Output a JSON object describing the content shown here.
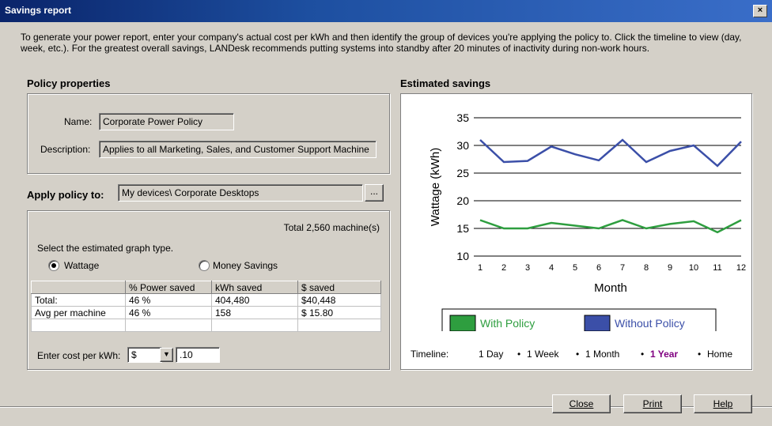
{
  "window": {
    "title": "Savings report",
    "close_glyph": "×"
  },
  "intro": "To generate your power report, enter your company's actual cost per kWh and then identify the group of devices you're applying the policy to. Click the timeline to view (day, week, etc.).  For the greatest overall savings, LANDesk recommends putting systems into standby after 20 minutes of inactivity during non-work hours.",
  "policy": {
    "heading": "Policy properties",
    "name_label": "Name:",
    "name_value": "Corporate Power Policy",
    "desc_label": "Description:",
    "desc_value": "Applies to all Marketing, Sales, and Customer Support Machine"
  },
  "apply": {
    "label": "Apply policy to:",
    "value": "My devices\\ Corporate Desktops",
    "browse_label": "..."
  },
  "stats": {
    "total": "Total 2,560 machine(s)",
    "graph_type_prompt": "Select the estimated graph type.",
    "radio_wattage": "Wattage",
    "radio_money": "Money Savings",
    "selected": "Wattage",
    "table": {
      "headers": [
        "",
        "% Power saved",
        "kWh saved",
        "$ saved"
      ],
      "rows": [
        [
          "Total:",
          "46 %",
          "404,480",
          "$40,448"
        ],
        [
          "Avg per machine",
          "46 %",
          "158",
          "$ 15.80"
        ],
        [
          "",
          "",
          "",
          ""
        ]
      ]
    },
    "cost_label": "Enter cost per kWh:",
    "currency": "$",
    "cost_value": ".10"
  },
  "estimated": {
    "heading": "Estimated savings"
  },
  "chart_data": {
    "type": "line",
    "xlabel": "Month",
    "ylabel": "Wattage (kWh)",
    "x": [
      1,
      2,
      3,
      4,
      5,
      6,
      7,
      8,
      9,
      10,
      11,
      12
    ],
    "ylim": [
      10,
      35
    ],
    "yticks": [
      10,
      15,
      20,
      25,
      30,
      35
    ],
    "grid": true,
    "legend_position": "bottom",
    "series": [
      {
        "name": "With Policy",
        "color": "#2e9e3f",
        "values": [
          16.5,
          15.0,
          15.0,
          16.0,
          15.5,
          15.0,
          16.5,
          15.0,
          15.8,
          16.3,
          14.3,
          16.5
        ]
      },
      {
        "name": "Without Policy",
        "color": "#3b4fa8",
        "values": [
          31.0,
          27.0,
          27.2,
          29.8,
          28.4,
          27.3,
          31.0,
          27.0,
          29.0,
          30.0,
          26.3,
          30.7
        ]
      }
    ]
  },
  "timeline": {
    "label": "Timeline:",
    "items": [
      "1 Day",
      "1 Week",
      "1 Month",
      "1 Year",
      "Home"
    ],
    "selected": "1 Year",
    "selected_color": "#800080",
    "bullet": "•"
  },
  "buttons": {
    "close": "Close",
    "print": "Print",
    "help": "Help"
  }
}
